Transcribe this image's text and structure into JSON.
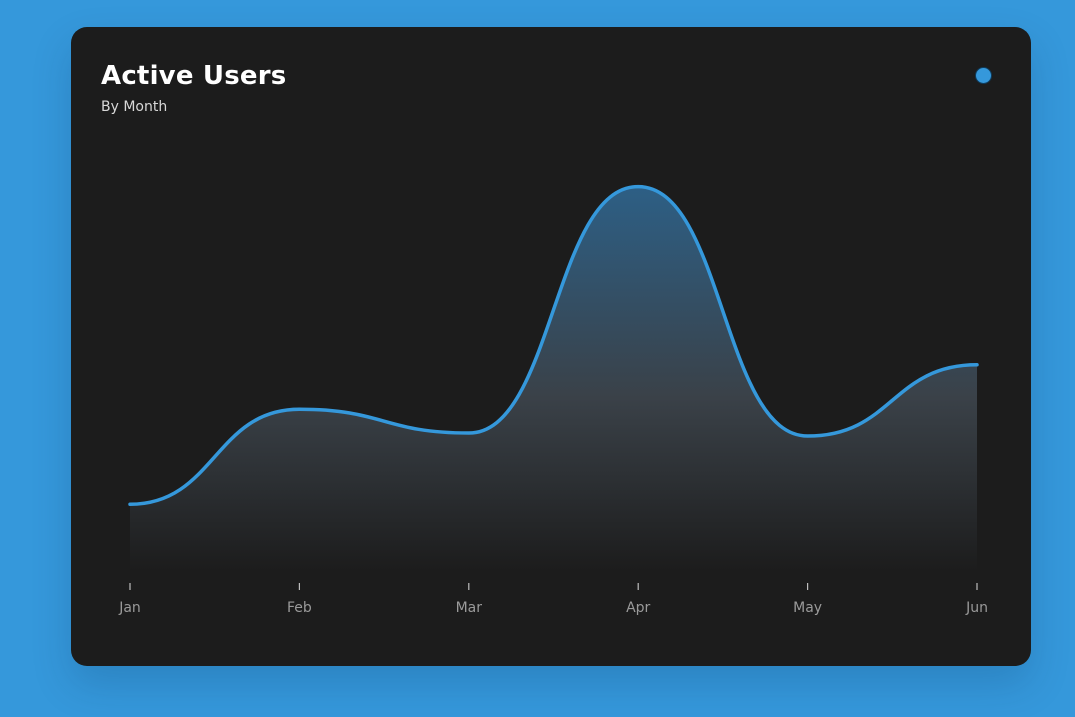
{
  "chart_data": {
    "type": "area",
    "title": "Active Users",
    "subtitle": "By Month",
    "categories": [
      "Jan",
      "Feb",
      "Mar",
      "Apr",
      "May",
      "Jun"
    ],
    "series": [
      {
        "values": [
          10,
          42,
          34,
          117,
          33,
          57
        ]
      }
    ],
    "ylim": [
      0,
      130
    ],
    "grid": false,
    "legend": "top-right",
    "colors": {
      "line": "#3598db",
      "fill_top": "#2d5f85",
      "fill_bottom": "#1c1c1c",
      "card": "#1c1c1c",
      "page": "#3598db",
      "tick": "#9a9a9a"
    }
  }
}
